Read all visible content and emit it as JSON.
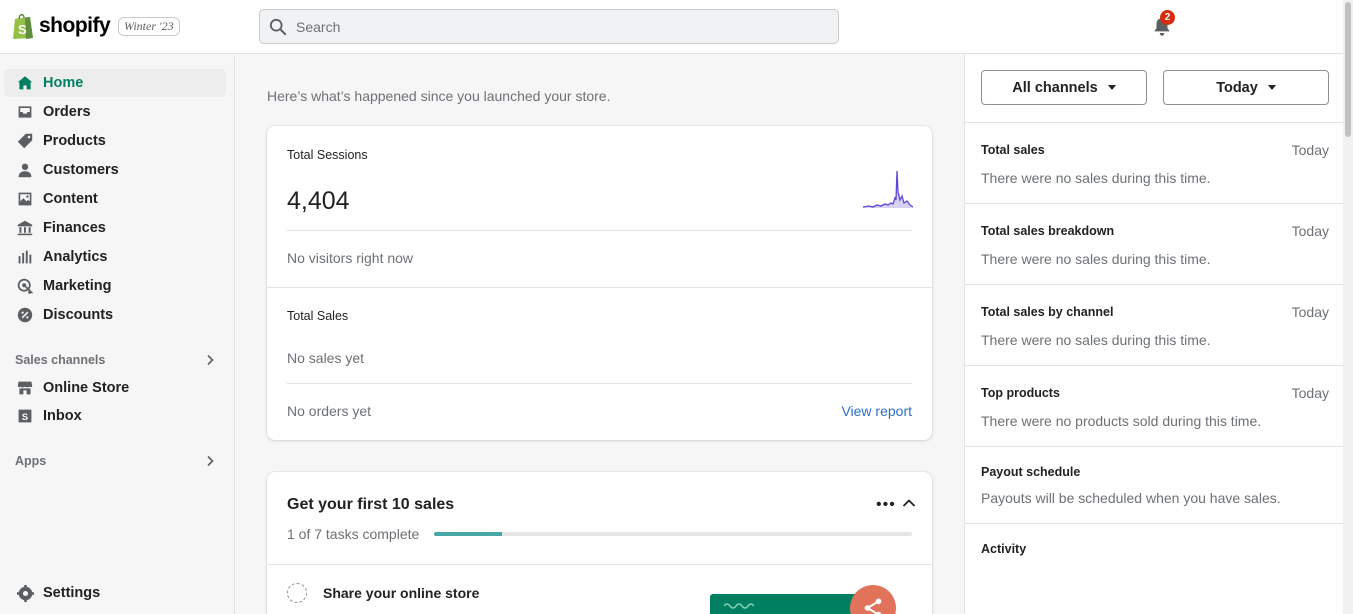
{
  "brand": {
    "name": "shopify",
    "edition": "Winter '23"
  },
  "search": {
    "placeholder": "Search"
  },
  "notifications": {
    "count": "2"
  },
  "sidebar": {
    "items": [
      {
        "label": "Home",
        "icon": "home-icon"
      },
      {
        "label": "Orders",
        "icon": "orders-icon"
      },
      {
        "label": "Products",
        "icon": "tag-icon"
      },
      {
        "label": "Customers",
        "icon": "person-icon"
      },
      {
        "label": "Content",
        "icon": "image-icon"
      },
      {
        "label": "Finances",
        "icon": "bank-icon"
      },
      {
        "label": "Analytics",
        "icon": "bar-chart-icon"
      },
      {
        "label": "Marketing",
        "icon": "target-icon"
      },
      {
        "label": "Discounts",
        "icon": "discount-icon"
      }
    ],
    "sales_channels_label": "Sales channels",
    "channels": [
      {
        "label": "Online Store",
        "icon": "store-icon"
      },
      {
        "label": "Inbox",
        "icon": "inbox-icon"
      }
    ],
    "apps_label": "Apps",
    "settings_label": "Settings"
  },
  "main": {
    "intro": "Here’s what’s happened since you launched your store.",
    "overview": {
      "sessions_label": "Total Sessions",
      "sessions_value": "4,404",
      "visitors_text": "No visitors right now",
      "sales_label": "Total Sales",
      "sales_text": "No sales yet",
      "orders_text": "No orders yet",
      "view_report": "View report"
    },
    "tasks": {
      "title": "Get your first 10 sales",
      "progress_text": "1 of 7 tasks complete",
      "progress_fraction": 0.1429,
      "first_task": "Share your online store"
    }
  },
  "right": {
    "channel_filter": "All channels",
    "date_filter": "Today",
    "metrics": [
      {
        "title": "Total sales",
        "range": "Today",
        "desc": "There were no sales during this time."
      },
      {
        "title": "Total sales breakdown",
        "range": "Today",
        "desc": "There were no sales during this time."
      },
      {
        "title": "Total sales by channel",
        "range": "Today",
        "desc": "There were no sales during this time."
      },
      {
        "title": "Top products",
        "range": "Today",
        "desc": "There were no products sold during this time."
      },
      {
        "title": "Payout schedule",
        "range": "",
        "desc": "Payouts will be scheduled when you have sales."
      },
      {
        "title": "Activity",
        "range": "",
        "desc": ""
      }
    ]
  },
  "colors": {
    "accent": "#008060",
    "link": "#2c6ecb",
    "badge": "#d72c0d",
    "progress": "#47a6a6",
    "sparkline": "#5c48d6"
  }
}
